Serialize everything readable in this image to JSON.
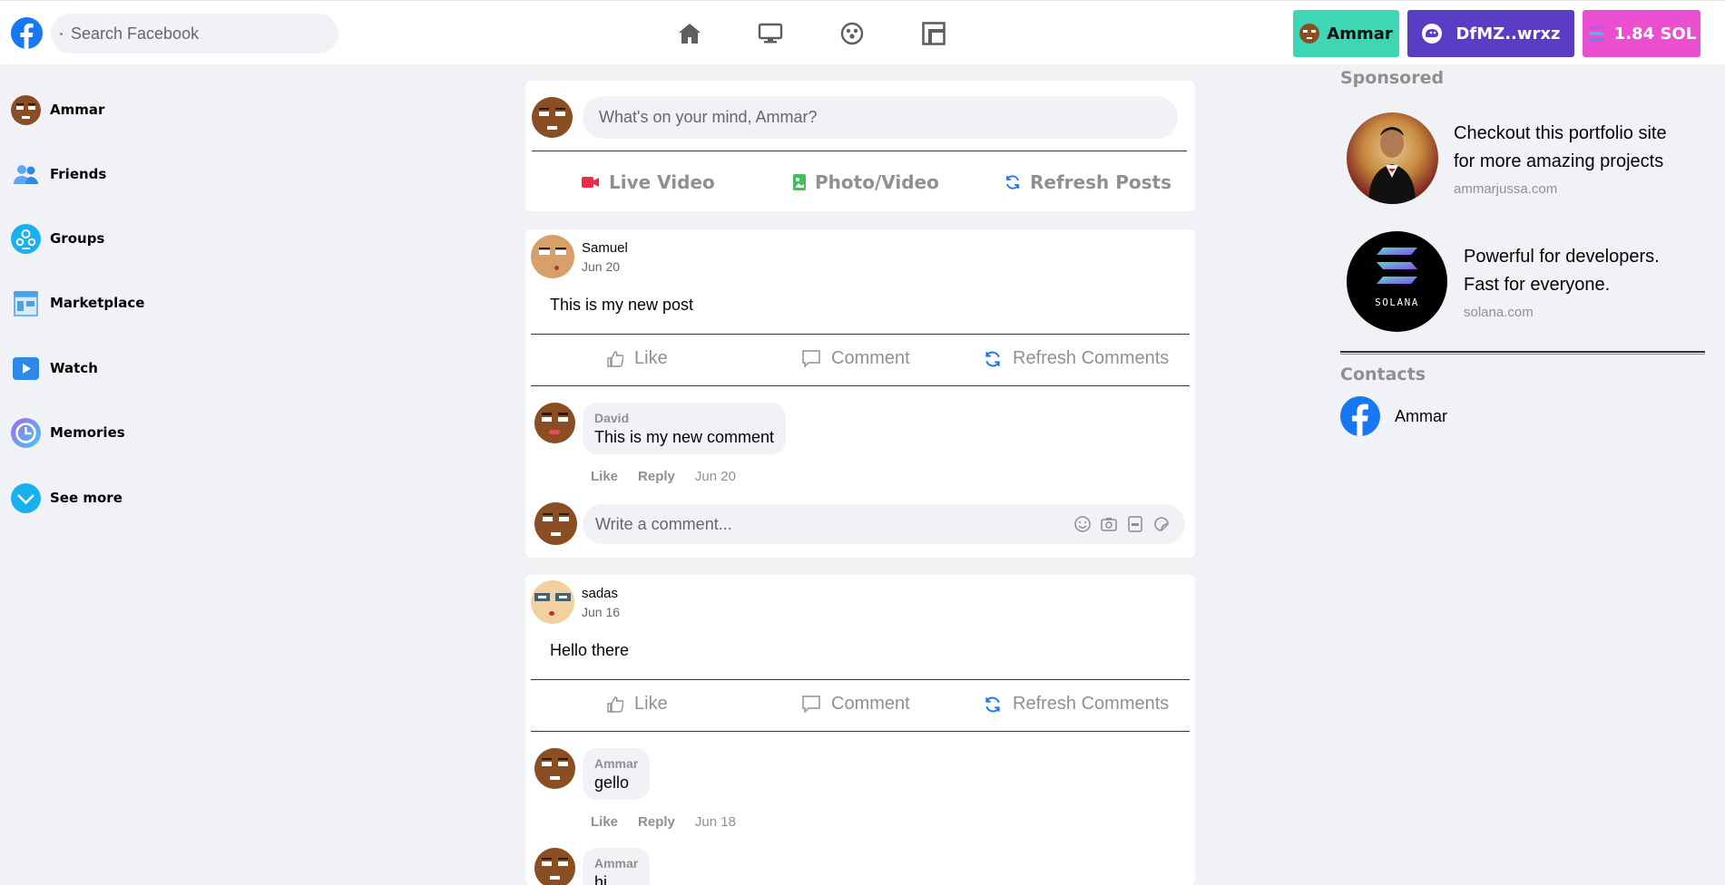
{
  "header": {
    "search_placeholder": "Search Facebook",
    "nav_icons": [
      "home-icon",
      "watch-icon",
      "groups-icon",
      "gaming-icon"
    ],
    "user_pill": "Ammar",
    "wallet_pill": "DfMZ..wrxz",
    "balance_pill": "1.84 SOL"
  },
  "sidebar": {
    "items": [
      {
        "label": "Ammar",
        "icon": "user-avatar"
      },
      {
        "label": "Friends",
        "icon": "friends-icon"
      },
      {
        "label": "Groups",
        "icon": "groups-icon"
      },
      {
        "label": "Marketplace",
        "icon": "marketplace-icon"
      },
      {
        "label": "Watch",
        "icon": "watch-icon"
      },
      {
        "label": "Memories",
        "icon": "memories-icon"
      },
      {
        "label": "See more",
        "icon": "chevron-down-icon"
      }
    ]
  },
  "composer": {
    "placeholder": "What's on your mind, Ammar?",
    "live_video": "Live Video",
    "photo_video": "Photo/Video",
    "refresh_posts": "Refresh Posts"
  },
  "posts": [
    {
      "author": "Samuel",
      "date": "Jun 20",
      "text": "This is my new post",
      "like": "Like",
      "comment": "Comment",
      "refresh": "Refresh Comments",
      "comments": [
        {
          "author": "David",
          "text": "This is my new comment",
          "like": "Like",
          "reply": "Reply",
          "date": "Jun 20"
        }
      ],
      "write_placeholder": "Write a comment..."
    },
    {
      "author": "sadas",
      "date": "Jun 16",
      "text": "Hello there",
      "like": "Like",
      "comment": "Comment",
      "refresh": "Refresh Comments",
      "comments": [
        {
          "author": "Ammar",
          "text": "gello",
          "like": "Like",
          "reply": "Reply",
          "date": "Jun 18"
        },
        {
          "author": "Ammar",
          "text": "hi"
        }
      ]
    }
  ],
  "right": {
    "sponsored_title": "Sponsored",
    "ads": [
      {
        "title_line1": "Checkout this portfolio site",
        "title_line2": "for more amazing projects",
        "site": "ammarjussa.com"
      },
      {
        "title_line1": "Powerful for developers.",
        "title_line2": "Fast for everyone.",
        "site": "solana.com",
        "logo_text": "SOLANA"
      }
    ],
    "contacts_title": "Contacts",
    "contacts": [
      {
        "name": "Ammar"
      }
    ]
  },
  "colors": {
    "brand": "#1877f2",
    "user_pill": "#3ed6b4",
    "wallet_pill": "#5b3cc4",
    "sol_pill": "#e94fcf"
  }
}
